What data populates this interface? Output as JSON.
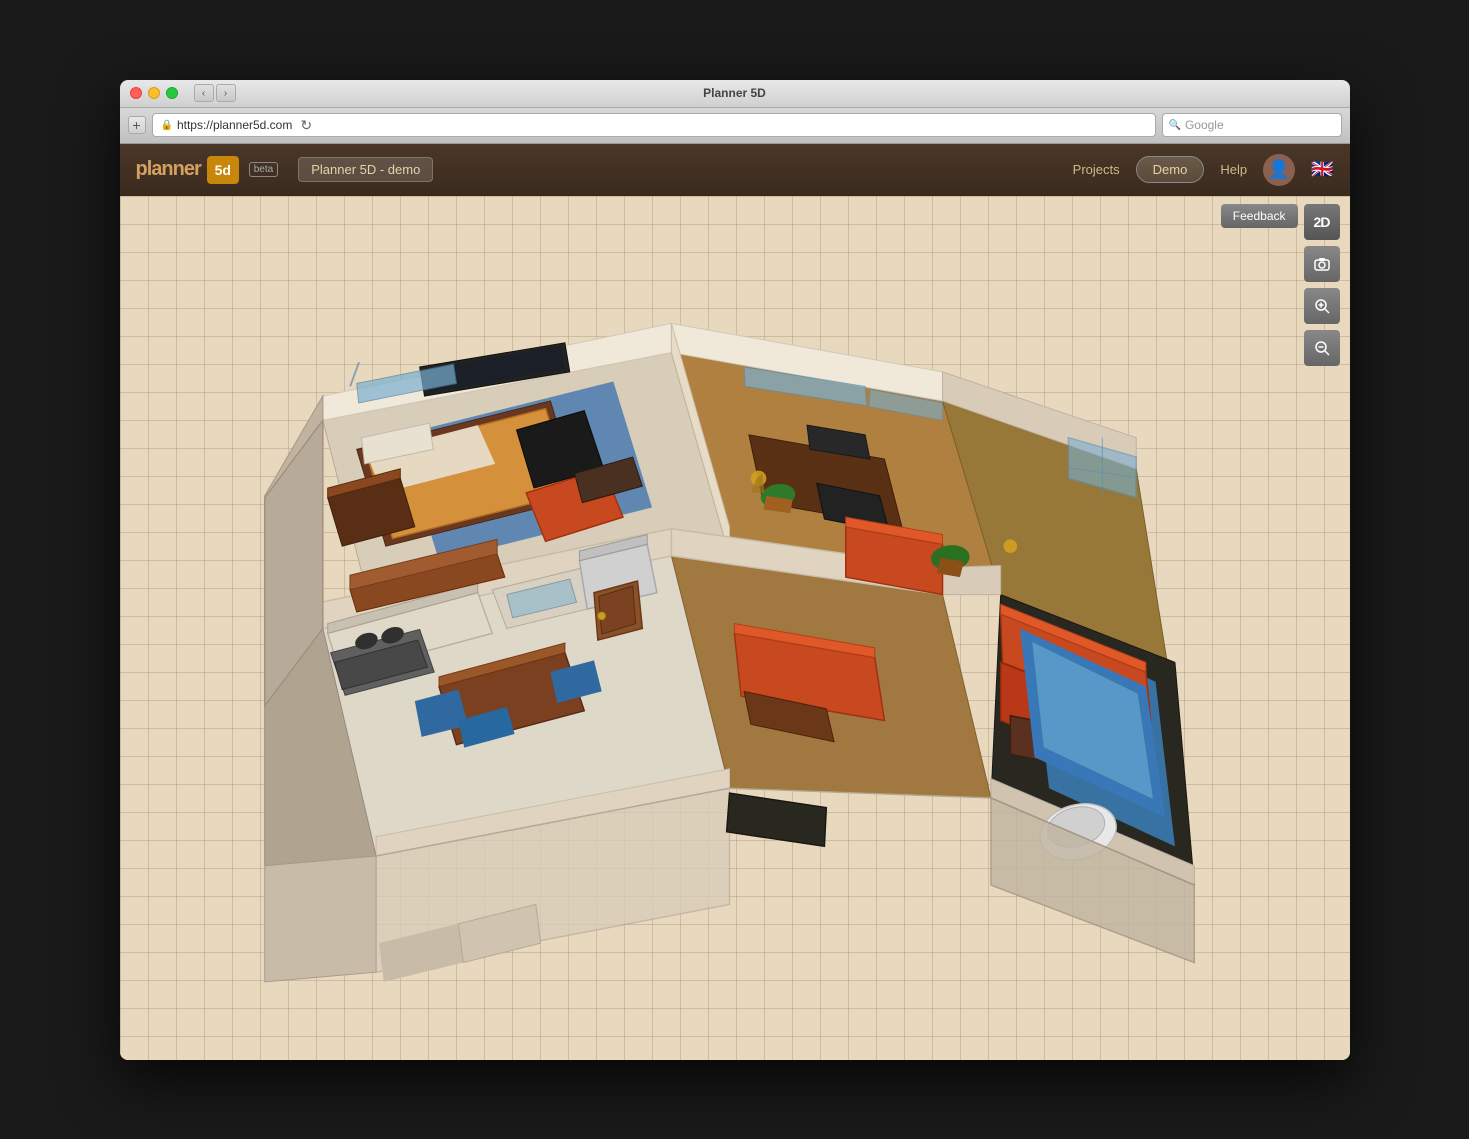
{
  "window": {
    "title": "Planner 5D",
    "title_bar_title": "Planner 5D"
  },
  "browser": {
    "url": "https://planner5d.com",
    "search_placeholder": "Google",
    "nav_back": "‹",
    "nav_forward": "›"
  },
  "app": {
    "logo_text": "planner",
    "logo_suffix": "5d",
    "beta_label": "beta",
    "project_name": "Planner 5D - demo",
    "nav_projects": "Projects",
    "nav_demo": "Demo",
    "nav_help": "Help"
  },
  "toolbar": {
    "feedback_label": "Feedback",
    "btn_2d": "2D",
    "btn_camera": "📷",
    "btn_zoom_in": "🔍+",
    "btn_zoom_out": "🔍-"
  },
  "icons": {
    "back": "‹",
    "forward": "›",
    "refresh": "↻",
    "search": "🔍",
    "lock": "🔒",
    "flag_uk": "🇬🇧",
    "camera": "◉",
    "zoom_in": "⊕",
    "zoom_out": "⊖"
  }
}
